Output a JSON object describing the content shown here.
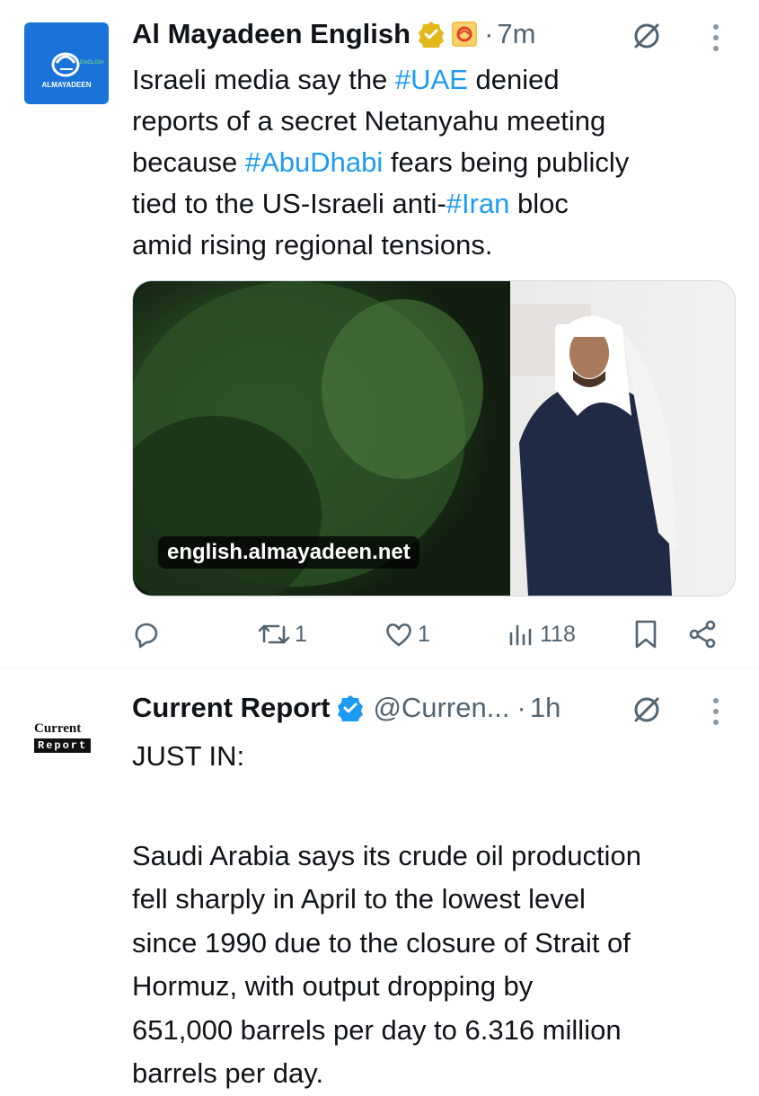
{
  "tweets": [
    {
      "display_name": "Al Mayadeen English",
      "handle": "",
      "time": "7m",
      "avatar_label": "ALMAYADEEN",
      "text_parts": [
        {
          "t": "Israeli media say the ",
          "tag": false
        },
        {
          "t": "#UAE",
          "tag": true
        },
        {
          "t": " denied",
          "tag": false
        }
      ],
      "lines": [
        [
          {
            "t": "Israeli media say the ",
            "tag": false
          },
          {
            "t": "#UAE",
            "tag": true
          },
          {
            "t": " denied",
            "tag": false
          }
        ],
        [
          {
            "t": "reports of a secret Netanyahu meeting",
            "tag": false
          }
        ],
        [
          {
            "t": "because ",
            "tag": false
          },
          {
            "t": "#AbuDhabi",
            "tag": true
          },
          {
            "t": " fears being publicly",
            "tag": false
          }
        ],
        [
          {
            "t": "tied to the US-Israeli anti-",
            "tag": false
          },
          {
            "t": "#Iran",
            "tag": true
          },
          {
            "t": " bloc",
            "tag": false
          }
        ],
        [
          {
            "t": "amid rising regional tensions.",
            "tag": false
          }
        ]
      ],
      "link_domain": "english.almayadeen.net",
      "actions": {
        "reply": "",
        "retweet": "1",
        "like": "1",
        "views": "118"
      }
    },
    {
      "display_name": "Current Report",
      "handle": "@Curren...",
      "time": "1h",
      "avatar_label_top": "Current",
      "avatar_label_bottom": "Report",
      "lines": [
        [
          {
            "t": "JUST IN:",
            "tag": false
          }
        ],
        [
          {
            "t": "",
            "tag": false
          }
        ],
        [
          {
            "t": "",
            "tag": false
          }
        ],
        [
          {
            "t": "Saudi Arabia says its crude oil production",
            "tag": false
          }
        ],
        [
          {
            "t": "fell sharply in April to the lowest level",
            "tag": false
          }
        ],
        [
          {
            "t": "since 1990 due to the closure of Strait of",
            "tag": false
          }
        ],
        [
          {
            "t": "Hormuz, with output dropping by",
            "tag": false
          }
        ],
        [
          {
            "t": "651,000 barrels per day to 6.316 million",
            "tag": false
          }
        ],
        [
          {
            "t": "barrels per day.",
            "tag": false
          }
        ]
      ]
    }
  ],
  "separator": "·",
  "colors": {
    "accent": "#1d9bf0",
    "muted": "#536471",
    "gold_badge": "#e2b719",
    "blue_badge": "#1d9bf0",
    "avatar_blue": "#1a73d9"
  },
  "icons": [
    "grok-icon",
    "more-icon",
    "reply-icon",
    "retweet-icon",
    "like-icon",
    "views-icon",
    "bookmark-icon",
    "share-icon",
    "verified-gold-icon",
    "affiliate-badge-icon",
    "verified-blue-icon"
  ]
}
